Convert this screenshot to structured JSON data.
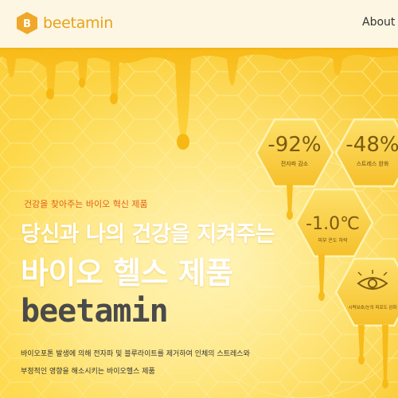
{
  "header": {
    "logo_text_a": "bee",
    "logo_text_b": "tamin",
    "nav_about": "About U"
  },
  "hero": {
    "tagline": "건강을 찾아주는 바이오 혁신 제품",
    "headline1": "당신과 나의 건강을 지켜주는",
    "headline2": "바이오 헬스 제품",
    "brand": "beetamin",
    "desc_line1": "바이오포톤 발생에 의해 전자파 및 블루라이트를 제거하여 인체의 스트레스와",
    "desc_line2": "부정적인 영향을 해소시키는 바이오헬스 제품"
  },
  "stats": [
    {
      "value": "-92%",
      "label": "전자파 감소"
    },
    {
      "value": "-48%",
      "label": "스트레스 완화"
    },
    {
      "value": "-1.0℃",
      "label": "피부 온도 하락"
    },
    {
      "value": "",
      "label": "시력보호/눈의 피로도 완화"
    }
  ],
  "colors": {
    "honey": "#fcd34a",
    "accent": "#e8a21a",
    "tagline": "#e0611a"
  }
}
